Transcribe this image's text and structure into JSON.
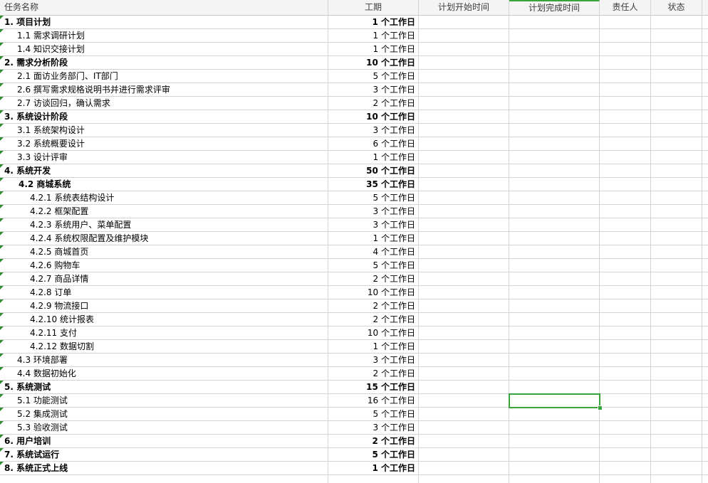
{
  "columns": {
    "task": "任务名称",
    "duration": "工期",
    "plan_start": "计划开始时间",
    "plan_end": "计划完成时间",
    "owner": "责任人",
    "status": "状态"
  },
  "rows": [
    {
      "task": "1.  项目计划",
      "duration": "1 个工作日",
      "level": 1
    },
    {
      "task": "1.1 需求调研计划",
      "duration": "1 个工作日",
      "level": 2
    },
    {
      "task": "1.4 知识交接计划",
      "duration": "1 个工作日",
      "level": 2
    },
    {
      "task": "2.  需求分析阶段",
      "duration": "10 个工作日",
      "level": 1
    },
    {
      "task": "2.1 面访业务部门、IT部门",
      "duration": "5 个工作日",
      "level": 2
    },
    {
      "task": "2.6 撰写需求规格说明书并进行需求评审",
      "duration": "3 个工作日",
      "level": 2
    },
    {
      "task": "2.7 访谈回归，确认需求",
      "duration": "2 个工作日",
      "level": 2
    },
    {
      "task": "3.  系统设计阶段",
      "duration": "10 个工作日",
      "level": 1
    },
    {
      "task": "3.1 系统架构设计",
      "duration": "3 个工作日",
      "level": 2
    },
    {
      "task": "3.2 系统概要设计",
      "duration": "6 个工作日",
      "level": 2
    },
    {
      "task": "3.3 设计评审",
      "duration": "1 个工作日",
      "level": 2
    },
    {
      "task": "4.  系统开发",
      "duration": "50 个工作日",
      "level": 1
    },
    {
      "task": "4.2  商城系统",
      "duration": "35 个工作日",
      "level": "2b"
    },
    {
      "task": "4.2.1 系统表结构设计",
      "duration": "5 个工作日",
      "level": 3
    },
    {
      "task": "4.2.2 框架配置",
      "duration": "3 个工作日",
      "level": 3
    },
    {
      "task": "4.2.3 系统用户、菜单配置",
      "duration": "3 个工作日",
      "level": 3
    },
    {
      "task": "4.2.4 系统权限配置及维护模块",
      "duration": "1 个工作日",
      "level": 3
    },
    {
      "task": "4.2.5 商城首页",
      "duration": "4 个工作日",
      "level": 3
    },
    {
      "task": "4.2.6 购物车",
      "duration": "5 个工作日",
      "level": 3
    },
    {
      "task": "4.2.7 商品详情",
      "duration": "2 个工作日",
      "level": 3
    },
    {
      "task": "4.2.8 订单",
      "duration": "10 个工作日",
      "level": 3
    },
    {
      "task": "4.2.9 物流接口",
      "duration": "2 个工作日",
      "level": 3
    },
    {
      "task": "4.2.10 统计报表",
      "duration": "2 个工作日",
      "level": 3
    },
    {
      "task": "4.2.11 支付",
      "duration": "10 个工作日",
      "level": 3
    },
    {
      "task": "4.2.12 数据切割",
      "duration": "1 个工作日",
      "level": 3
    },
    {
      "task": "4.3 环境部署",
      "duration": "3 个工作日",
      "level": 2
    },
    {
      "task": "4.4 数据初始化",
      "duration": "2 个工作日",
      "level": 2
    },
    {
      "task": "5.  系统测试",
      "duration": "15 个工作日",
      "level": 1
    },
    {
      "task": "5.1 功能测试",
      "duration": "16 个工作日",
      "level": 2
    },
    {
      "task": "5.2 集成测试",
      "duration": "5 个工作日",
      "level": 2
    },
    {
      "task": "5.3 验收测试",
      "duration": "3 个工作日",
      "level": 2
    },
    {
      "task": "6.  用户培训",
      "duration": "2 个工作日",
      "level": 1
    },
    {
      "task": "7.  系统试运行",
      "duration": "5 个工作日",
      "level": 1
    },
    {
      "task": "8.  系统正式上线",
      "duration": "1 个工作日",
      "level": 1
    }
  ],
  "colors": {
    "grid": "#d4d4d4",
    "header_bg": "#f4f4f4",
    "selection": "#3ba33b",
    "error_marker": "#2e8b2e"
  }
}
